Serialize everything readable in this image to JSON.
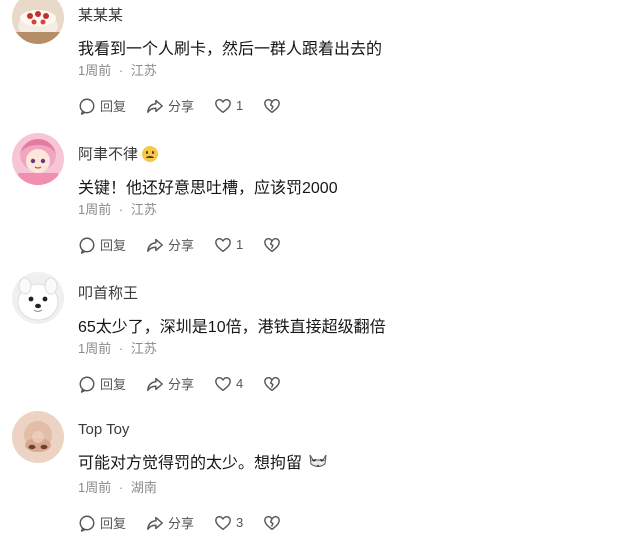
{
  "comments": [
    {
      "username": "某某某",
      "content": "我看到一个人刷卡，然后一群人跟着出去的",
      "time": "1周前",
      "sep": "·",
      "location": "江苏",
      "reply_label": "回复",
      "share_label": "分享",
      "likes": "1",
      "avatar": "cake-avatar"
    },
    {
      "username": "阿聿不律",
      "username_emoji": "pleading-face-emoji",
      "content": "关键！他还好意思吐槽，应该罚2000",
      "time": "1周前",
      "sep": "·",
      "location": "江苏",
      "reply_label": "回复",
      "share_label": "分享",
      "likes": "1",
      "avatar": "anime-girl-avatar"
    },
    {
      "username": "叩首称王",
      "content": "65太少了，深圳是10倍，港铁直接超级翻倍",
      "time": "1周前",
      "sep": "·",
      "location": "江苏",
      "reply_label": "回复",
      "share_label": "分享",
      "likes": "4",
      "avatar": "white-dog-avatar"
    },
    {
      "username": "Top Toy",
      "content": "可能对方觉得罚的太少。想拘留",
      "content_emoji": "cat-emoji",
      "time": "1周前",
      "sep": "·",
      "location": "湖南",
      "reply_label": "回复",
      "share_label": "分享",
      "likes": "3",
      "avatar": "nose-avatar"
    }
  ],
  "colors": {
    "text": "#161616",
    "meta": "#8a8a8a",
    "icon": "#555555"
  }
}
